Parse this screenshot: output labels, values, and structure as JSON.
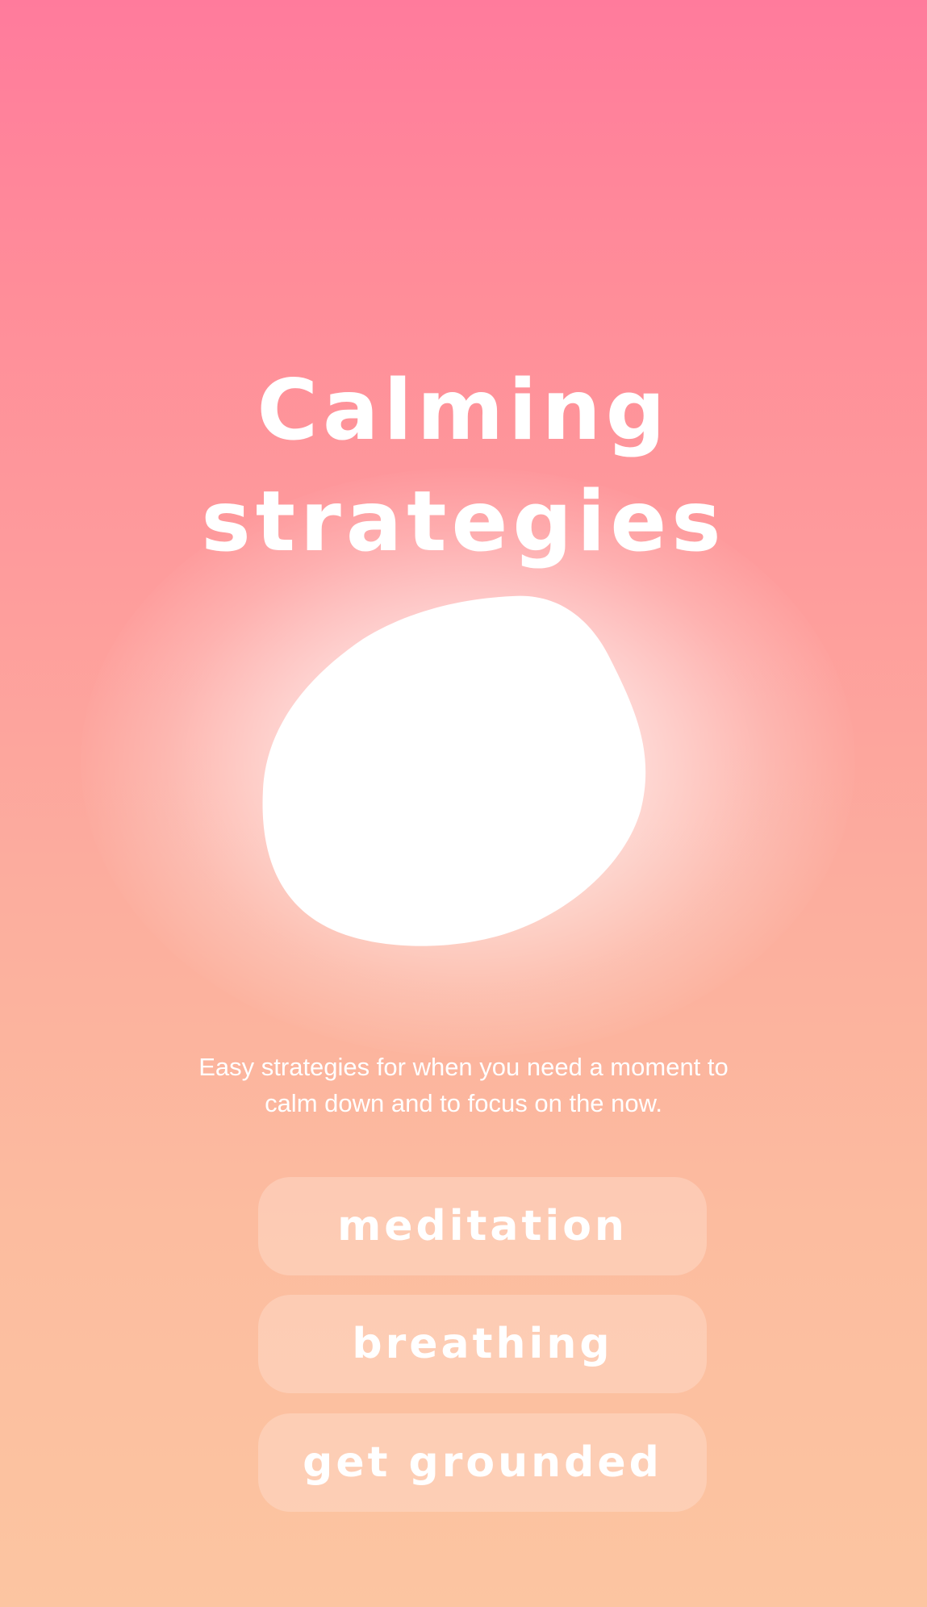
{
  "header": {
    "title_line1": "Calming",
    "title_line2": "strategies"
  },
  "description": {
    "line1": "Easy strategies for when you need a moment to",
    "line2": "calm down and to focus on the now."
  },
  "strategies": [
    {
      "label": "meditation"
    },
    {
      "label": "breathing"
    },
    {
      "label": "get grounded"
    }
  ],
  "colors": {
    "gradient_top": "#ff7b9c",
    "gradient_bottom": "#fcc5a1",
    "text": "#ffffff",
    "blob": "#ffffff"
  }
}
